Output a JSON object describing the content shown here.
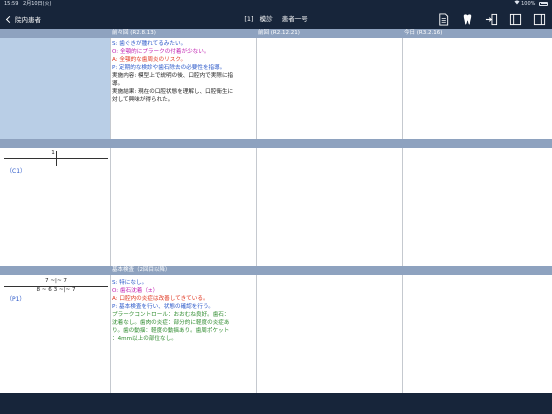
{
  "status": {
    "time": "15:59",
    "date": "2月10日(火)",
    "battery": "100%"
  },
  "nav": {
    "back_label": "院内患者",
    "title_no": "[1]",
    "title_name": "模診",
    "title_patient": "患者一号"
  },
  "columns": [
    {
      "label": "前々回 (R2.8.13)"
    },
    {
      "label": "前回 (R2.12.21)"
    },
    {
      "label": "今日 (R3.2.16)"
    }
  ],
  "sections": {
    "first_note": [
      {
        "cls": "s",
        "text": "S: 歯ぐきが腫れてるみたい。"
      },
      {
        "cls": "o",
        "text": "O: 全顎的にプラークの付着が少ない。"
      },
      {
        "cls": "a",
        "text": "A: 全顎的な歯周炎のリスク。"
      },
      {
        "cls": "p",
        "text": "P: 定期的な検診や歯石除去の必要性を指導。"
      },
      {
        "cls": "plain",
        "text": "実施内容: 模型上で説明の後、口腔内で実際に指"
      },
      {
        "cls": "plain",
        "text": "導。"
      },
      {
        "cls": "plain",
        "text": "実施結果: 現在の口腔状態を理解し、口腔衛生に"
      },
      {
        "cls": "plain",
        "text": "対して興味が得られた。"
      }
    ],
    "row2": {
      "tooth_top": "1",
      "code": "（C1）"
    },
    "row3": {
      "header": "基本検査（2回目以降）",
      "tooth_top": "7 ~|~ 7",
      "tooth_bottom": "8 ~ 6 3 ~|~ 7",
      "code": "（P1）",
      "note": [
        {
          "cls": "s",
          "text": "S: 特になし。"
        },
        {
          "cls": "o",
          "text": "O: 歯石沈着（±）"
        },
        {
          "cls": "a",
          "text": "A: 口腔内の炎症は改善してきている。"
        },
        {
          "cls": "p",
          "text": "P: 基本検査を行い、状態の確認を行う。"
        },
        {
          "cls": "g",
          "text": "プラークコントロール：おおむね良好。歯石："
        },
        {
          "cls": "g",
          "text": "沈着なし。歯肉の炎症：部分的に軽度の炎症あ"
        },
        {
          "cls": "g",
          "text": "り。歯の動揺：軽度の動揺あり。歯周ポケット"
        },
        {
          "cls": "g",
          "text": "：4mm以上の部位なし。"
        }
      ]
    }
  },
  "icons": [
    "document-icon",
    "tooth-icon",
    "import-icon",
    "left-panel-icon",
    "right-panel-icon"
  ],
  "colors": {
    "bar": "#17253a",
    "header": "#8ea2bf",
    "side": "#b9cee6"
  }
}
